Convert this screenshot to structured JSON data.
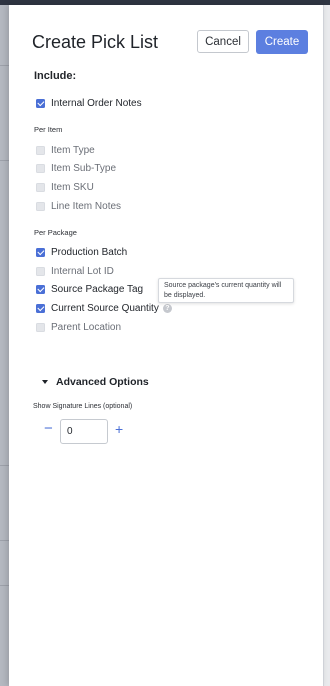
{
  "dialog": {
    "title": "Create Pick List",
    "cancel_label": "Cancel",
    "create_label": "Create"
  },
  "include": {
    "title": "Include:",
    "top_options": [
      {
        "label": "Internal Order Notes",
        "checked": true
      }
    ],
    "per_item": {
      "heading": "Per Item",
      "options": [
        {
          "label": "Item Type",
          "checked": false
        },
        {
          "label": "Item Sub-Type",
          "checked": false
        },
        {
          "label": "Item SKU",
          "checked": false
        },
        {
          "label": "Line Item Notes",
          "checked": false
        }
      ]
    },
    "per_package": {
      "heading": "Per Package",
      "options": [
        {
          "label": "Production Batch",
          "checked": true
        },
        {
          "label": "Internal Lot ID",
          "checked": false
        },
        {
          "label": "Source Package Tag",
          "checked": true
        },
        {
          "label": "Current Source Quantity",
          "checked": true,
          "help_icon": "question-icon"
        },
        {
          "label": "Parent Location",
          "checked": false
        }
      ]
    }
  },
  "tooltip": {
    "text": "Source package's current quantity will be displayed."
  },
  "advanced": {
    "label": "Advanced Options",
    "signature_label": "Show Signature Lines (optional)",
    "signature_value": "0",
    "minus_symbol": "−",
    "plus_symbol": "+"
  },
  "colors": {
    "accent": "#4a6fd6",
    "primary_button": "#5c7fe0",
    "backdrop": "#8d9099"
  }
}
